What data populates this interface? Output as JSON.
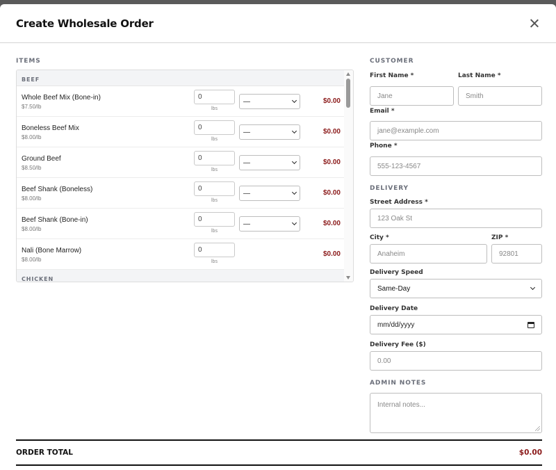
{
  "modal": {
    "title": "Create Wholesale Order"
  },
  "items": {
    "section_label": "ITEMS",
    "categories": [
      {
        "name": "BEEF",
        "rows": [
          {
            "name": "Whole Beef Mix (Bone-in)",
            "price": "$7.50/lb",
            "qty": "0",
            "unit": "lbs",
            "option": "—",
            "has_select": true,
            "total": "$0.00"
          },
          {
            "name": "Boneless Beef Mix",
            "price": "$8.00/lb",
            "qty": "0",
            "unit": "lbs",
            "option": "—",
            "has_select": true,
            "total": "$0.00"
          },
          {
            "name": "Ground Beef",
            "price": "$8.50/lb",
            "qty": "0",
            "unit": "lbs",
            "option": "—",
            "has_select": true,
            "total": "$0.00"
          },
          {
            "name": "Beef Shank (Boneless)",
            "price": "$8.00/lb",
            "qty": "0",
            "unit": "lbs",
            "option": "—",
            "has_select": true,
            "total": "$0.00"
          },
          {
            "name": "Beef Shank (Bone-in)",
            "price": "$8.00/lb",
            "qty": "0",
            "unit": "lbs",
            "option": "—",
            "has_select": true,
            "total": "$0.00"
          },
          {
            "name": "Nali (Bone Marrow)",
            "price": "$8.00/lb",
            "qty": "0",
            "unit": "lbs",
            "option": "",
            "has_select": false,
            "total": "$0.00"
          }
        ]
      },
      {
        "name": "CHICKEN",
        "rows": []
      }
    ]
  },
  "customer": {
    "section_label": "CUSTOMER",
    "first_name": {
      "label": "First Name *",
      "placeholder": "Jane"
    },
    "last_name": {
      "label": "Last Name *",
      "placeholder": "Smith"
    },
    "email": {
      "label": "Email *",
      "placeholder": "jane@example.com"
    },
    "phone": {
      "label": "Phone *",
      "placeholder": "555-123-4567"
    }
  },
  "delivery": {
    "section_label": "DELIVERY",
    "street": {
      "label": "Street Address *",
      "placeholder": "123 Oak St"
    },
    "city": {
      "label": "City *",
      "placeholder": "Anaheim"
    },
    "zip": {
      "label": "ZIP *",
      "placeholder": "92801"
    },
    "speed": {
      "label": "Delivery Speed",
      "value": "Same-Day"
    },
    "date": {
      "label": "Delivery Date",
      "placeholder": "mm/dd/yyyy"
    },
    "fee": {
      "label": "Delivery Fee ($)",
      "placeholder": "0.00"
    }
  },
  "admin_notes": {
    "section_label": "ADMIN NOTES",
    "placeholder": "Internal notes..."
  },
  "order_total": {
    "label": "ORDER TOTAL",
    "value": "$0.00"
  }
}
